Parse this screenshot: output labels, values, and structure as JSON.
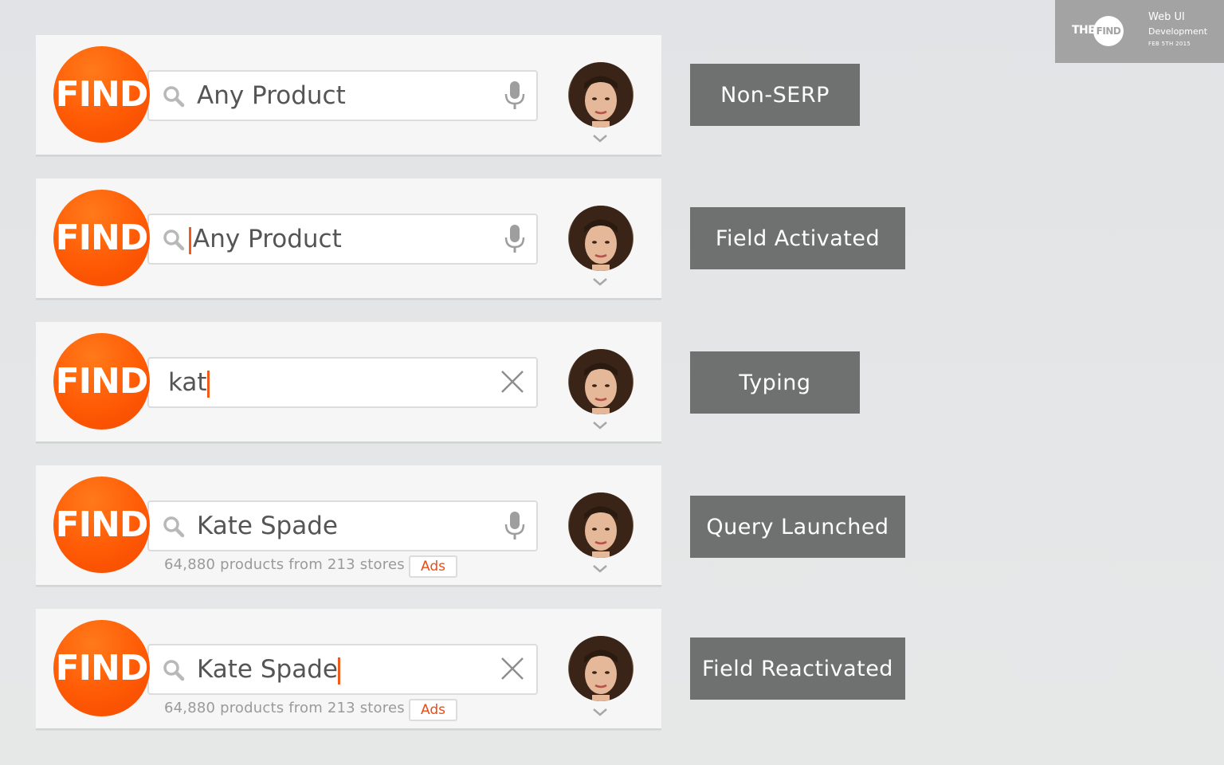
{
  "badge": {
    "brand_the": "THE",
    "brand_find": "FIND",
    "line1": "Web UI",
    "line2": "Development",
    "line3": "FEB 5TH 2015"
  },
  "colors": {
    "logo_orange": "#ff5a05",
    "cursor": "#f05a1a",
    "ads_text": "#f04a10",
    "label_bg": "#6f7070"
  },
  "rows": [
    {
      "logo": "FIND",
      "query": "Any Product",
      "trailing_icon": "microphone-icon",
      "state_label": "Non-SERP"
    },
    {
      "logo": "FIND",
      "query": "Any Product",
      "trailing_icon": "microphone-icon",
      "state_label": "Field Activated"
    },
    {
      "logo": "FIND",
      "query": "kat",
      "trailing_icon": "close-icon",
      "state_label": "Typing"
    },
    {
      "logo": "FIND",
      "query": "Kate Spade",
      "trailing_icon": "microphone-icon",
      "result_count": "64,880 products from 213 stores",
      "ads_label": "Ads",
      "state_label": "Query Launched"
    },
    {
      "logo": "FIND",
      "query": "Kate Spade",
      "trailing_icon": "close-icon",
      "result_count": "64,880 products from 213 stores",
      "ads_label": "Ads",
      "state_label": "Field Reactivated"
    }
  ]
}
